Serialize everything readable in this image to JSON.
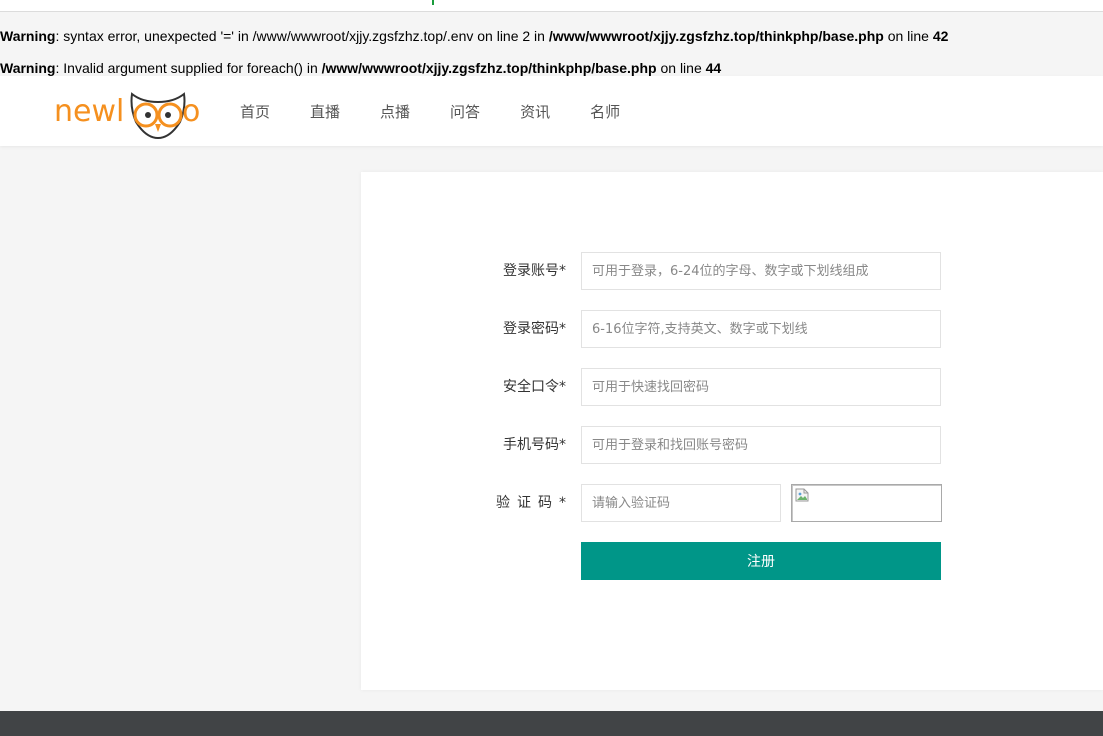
{
  "warnings": [
    {
      "label": "Warning",
      "message": ": syntax error, unexpected '=' in /www/wwwroot/xjjy.zgsfzhz.top/.env on line 2 in ",
      "file": "/www/wwwroot/xjjy.zgsfzhz.top/thinkphp/base.php",
      "on_line": " on line ",
      "line": "42"
    },
    {
      "label": "Warning",
      "message": ": Invalid argument supplied for foreach() in ",
      "file": "/www/wwwroot/xjjy.zgsfzhz.top/thinkphp/base.php",
      "on_line": " on line ",
      "line": "44"
    }
  ],
  "header": {
    "logo_text": "newl",
    "logo_text_tail": "o",
    "brand_color": "#f5901f",
    "nav": [
      "首页",
      "直播",
      "点播",
      "问答",
      "资讯",
      "名师"
    ]
  },
  "form": {
    "fields": [
      {
        "label": "登录账号",
        "required": "*",
        "placeholder": "可用于登录，6-24位的字母、数字或下划线组成",
        "value": ""
      },
      {
        "label": "登录密码",
        "required": "*",
        "placeholder": "6-16位字符,支持英文、数字或下划线",
        "value": ""
      },
      {
        "label": "安全口令",
        "required": "*",
        "placeholder": "可用于快速找回密码",
        "value": ""
      },
      {
        "label": "手机号码",
        "required": "*",
        "placeholder": "可用于登录和找回账号密码",
        "value": ""
      },
      {
        "label": "验证码",
        "required": "*",
        "placeholder": "请输入验证码",
        "value": ""
      }
    ],
    "submit_label": "注册",
    "accent_color": "#009688"
  },
  "icons": {
    "logo": "owl-logo-icon",
    "captcha": "broken-image-icon"
  }
}
